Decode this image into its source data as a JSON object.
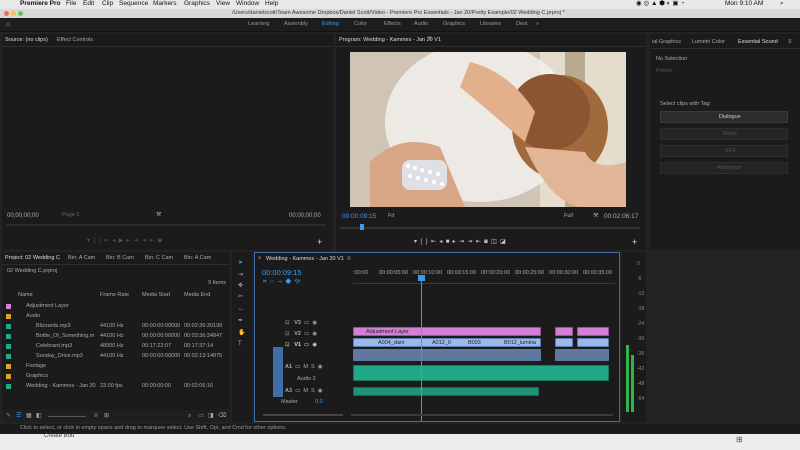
{
  "menubar": {
    "apple": "",
    "items": [
      "Premiere Pro",
      "File",
      "Edit",
      "Clip",
      "Sequence",
      "Markers",
      "Graphics",
      "View",
      "Window",
      "Help"
    ],
    "clock": "Mon 9:10 AM"
  },
  "titlebar": {
    "path": "/Users/danielscott/Team Awesome Dropbox/Daniel Scott/Video - Premiere Pro Essentials - Jan 20/Pretty Example/02 Wedding C.prproj *"
  },
  "workspaces": [
    "Learning",
    "Assembly",
    "Editing",
    "Color",
    "Effects",
    "Audio",
    "Graphics",
    "Libraries",
    "Dest"
  ],
  "source": {
    "tab": "Source: (no clips)",
    "tab2": "Effect Controls",
    "timecode_left": "00;00;00;00",
    "page": "Page 1",
    "timecode_right": "00;00;00;00"
  },
  "program": {
    "tab": "Program: Wedding - Kammes - Jan 20 V1",
    "timecode": "00:00:09:15",
    "fit": "Fit",
    "full": "Full",
    "duration": "00:02:06:17"
  },
  "right_panel": {
    "tabs": [
      "ial Graphics",
      "Lumetri Color",
      "Essential Sound"
    ],
    "no_selection": "No Selection",
    "preset": "Preset:",
    "clips_with_tag": "Select clips with Tag:",
    "dialogue": "Dialogue",
    "music": "Music",
    "sfx": "SFX",
    "ambience": "Ambience"
  },
  "project": {
    "tabs": [
      "Project: 02 Wedding C",
      "Bin: A Cam",
      "Bin: B Cam",
      "Bin: C Cam",
      "Bin: A Cam"
    ],
    "file": "02 Wedding C.prproj",
    "items_count": "9 Items",
    "columns": [
      "Name",
      "Frame Rate",
      "Media Start",
      "Media End"
    ],
    "rows": [
      {
        "name": "Adjustment Layer",
        "rate": "",
        "start": "",
        "end": "",
        "color": "#d37fd5"
      },
      {
        "name": "Audio",
        "rate": "",
        "start": "",
        "end": "",
        "color": "#e0a030"
      },
      {
        "name": "Blizzards.mp3",
        "rate": "44100 Hz",
        "start": "00:00:00:00000",
        "end": "00:02:36:30199",
        "color": "#21a888"
      },
      {
        "name": "Bottle_Of_Something.m",
        "rate": "44100 Hz",
        "start": "00:00:00:00000",
        "end": "00:03:36:34847",
        "color": "#21a888"
      },
      {
        "name": "Celebrant.mp3",
        "rate": "48000 Hz",
        "start": "00:17:22:07",
        "end": "00:17:37:14",
        "color": "#21a888"
      },
      {
        "name": "Sunday_Drive.mp3",
        "rate": "44100 Hz",
        "start": "00:00:00:00000",
        "end": "00:02:13:14875",
        "color": "#21a888"
      },
      {
        "name": "Footage",
        "rate": "",
        "start": "",
        "end": "",
        "color": "#e0a030"
      },
      {
        "name": "Graphics",
        "rate": "",
        "start": "",
        "end": "",
        "color": "#e0a030"
      },
      {
        "name": "Wedding - Kammes - Jan 20",
        "rate": "23.00 fps",
        "start": "00:00:00:00",
        "end": "00:02:06:16",
        "color": "#21a888"
      }
    ]
  },
  "timeline": {
    "tab": "Wedding - Kammes - Jan 20 V1",
    "timecode": "00:00:09:15",
    "ruler": [
      ":00:00",
      "00:00:05:00",
      "00:00:10:00",
      "00:00:15:00",
      "00:00:20:00",
      "00:00:25:00",
      "00:00:30:00",
      "00:00:35:00"
    ],
    "tracks_v": [
      "V3",
      "V2",
      "V1"
    ],
    "tracks_a": [
      "A1",
      "A2",
      "A3"
    ],
    "audio2_label": "Audio 2",
    "master": "Master",
    "master_val": "0.0",
    "adjustment_label": "Adjustment Layer",
    "v1_clips": [
      "A004_dam",
      "A012_0",
      "B003",
      "B012_lumina"
    ]
  },
  "meter": {
    "labels": [
      "0",
      "-6",
      "-12",
      "-18",
      "-24",
      "-30",
      "-36",
      "-42",
      "-48",
      "-54"
    ],
    "level_left": 0.45,
    "level_right": 0.38
  },
  "status": "Click to select, or click in empty space and drag to marquee select. Use Shift, Opt, and Cmd for other options.",
  "below": "Create Bod"
}
